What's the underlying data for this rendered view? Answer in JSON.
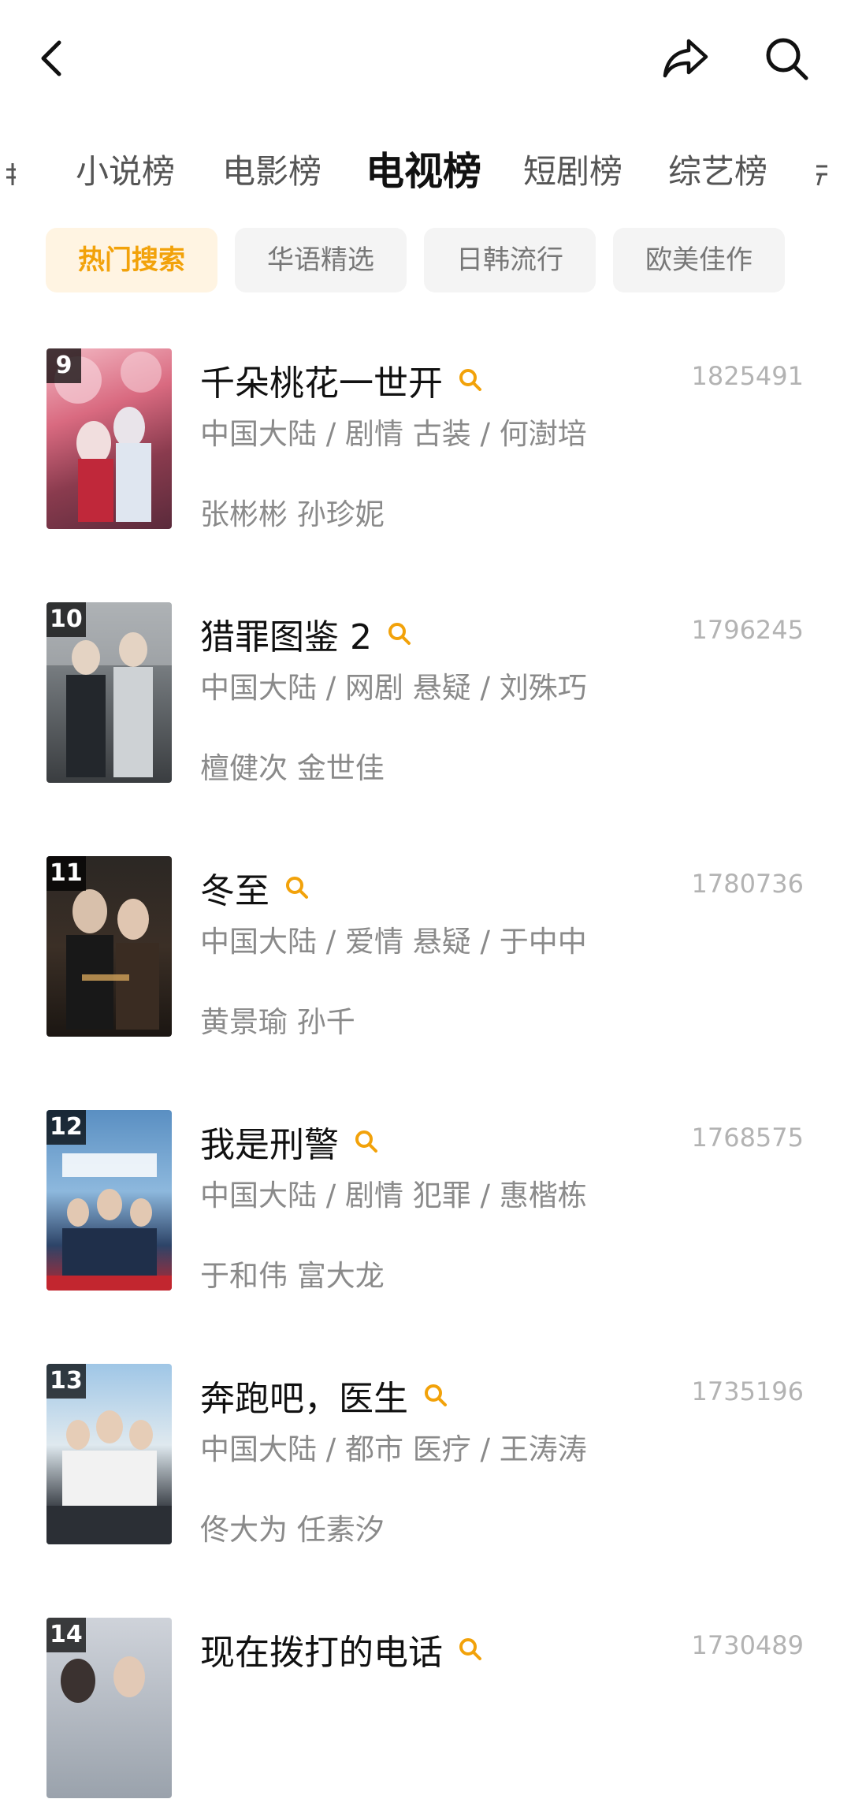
{
  "header": {
    "back_icon": "chevron-left-icon",
    "share_icon": "share-arrow-icon",
    "search_icon": "search-icon"
  },
  "categories": [
    {
      "label": "小说榜"
    },
    {
      "label": "电影榜"
    },
    {
      "label": "电视榜",
      "active": true
    },
    {
      "label": "短剧榜"
    },
    {
      "label": "综艺榜"
    }
  ],
  "chips": [
    {
      "label": "热门搜索",
      "active": true
    },
    {
      "label": "华语精选"
    },
    {
      "label": "日韩流行"
    },
    {
      "label": "欧美佳作"
    }
  ],
  "accent_color": "#f2a20a",
  "items": [
    {
      "rank": "9",
      "title": "千朵桃花一世开",
      "heat": "1825491",
      "meta": "中国大陆 / 剧情 古装 / 何澍培",
      "cast": "张彬彬 孙珍妮"
    },
    {
      "rank": "10",
      "title": "猎罪图鉴 2",
      "heat": "1796245",
      "meta": "中国大陆 / 网剧 悬疑 / 刘殊巧",
      "cast": "檀健次 金世佳"
    },
    {
      "rank": "11",
      "title": "冬至",
      "heat": "1780736",
      "meta": "中国大陆 / 爱情 悬疑 / 于中中",
      "cast": "黄景瑜 孙千"
    },
    {
      "rank": "12",
      "title": "我是刑警",
      "heat": "1768575",
      "meta": "中国大陆 / 剧情 犯罪 / 惠楷栋",
      "cast": "于和伟 富大龙"
    },
    {
      "rank": "13",
      "title": "奔跑吧，医生",
      "heat": "1735196",
      "meta": "中国大陆 / 都市 医疗 / 王涛涛",
      "cast": "佟大为 任素汐"
    },
    {
      "rank": "14",
      "title": "现在拨打的电话",
      "heat": "1730489",
      "meta": "",
      "cast": ""
    }
  ]
}
